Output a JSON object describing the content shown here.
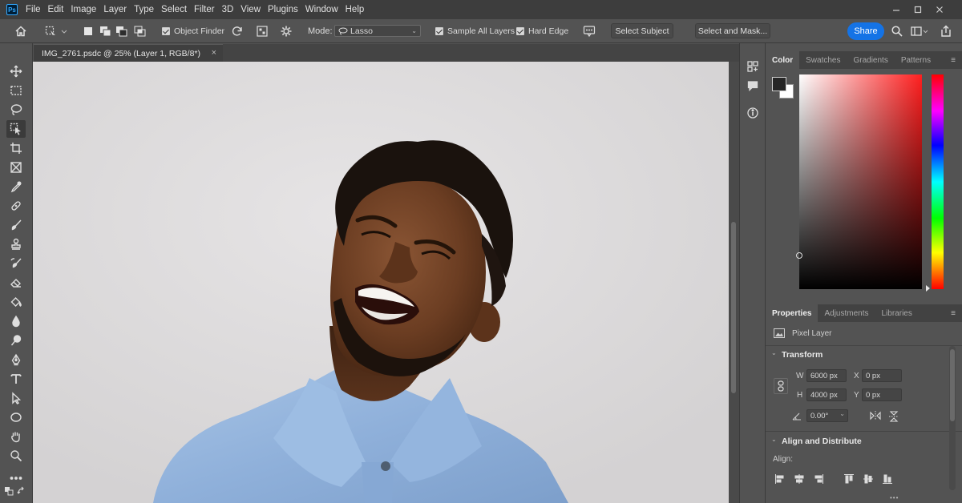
{
  "menubar": {
    "logo": "Ps",
    "items": [
      "File",
      "Edit",
      "Image",
      "Layer",
      "Type",
      "Select",
      "Filter",
      "3D",
      "View",
      "Plugins",
      "Window",
      "Help"
    ],
    "window_controls": [
      "minimize-icon",
      "maximize-icon",
      "close-icon"
    ]
  },
  "options_bar": {
    "object_finder_label": "Object Finder",
    "object_finder_checked": true,
    "mode_label": "Mode:",
    "mode_value": "Lasso",
    "sample_all_layers_label": "Sample All Layers",
    "sample_all_layers_checked": true,
    "hard_edge_label": "Hard Edge",
    "hard_edge_checked": true,
    "select_subject_label": "Select Subject",
    "select_and_mask_label": "Select and Mask...",
    "share_label": "Share",
    "accent_color": "#1473e6"
  },
  "toolbar": {
    "tools": [
      "move-icon",
      "marquee-icon",
      "lasso-icon",
      "object-selection-icon",
      "crop-icon",
      "frame-icon",
      "eyedropper-icon",
      "healing-brush-icon",
      "brush-icon",
      "clone-stamp-icon",
      "history-brush-icon",
      "eraser-icon",
      "paint-bucket-icon",
      "blur-icon",
      "dodge-icon",
      "pen-icon",
      "type-icon",
      "path-selection-icon",
      "ellipse-icon",
      "hand-icon",
      "zoom-icon",
      "more-tools-icon"
    ],
    "active_tool": "object-selection-icon"
  },
  "document": {
    "tab_title": "IMG_2761.psdc @ 25% (Layer 1, RGB/8*)",
    "close_glyph": "×"
  },
  "color_panel": {
    "tabs": [
      "Color",
      "Swatches",
      "Gradients",
      "Patterns"
    ],
    "active_tab": "Color",
    "foreground": "#262626",
    "background": "#ffffff",
    "hue": "#ff0000"
  },
  "properties_panel": {
    "tabs": [
      "Properties",
      "Adjustments",
      "Libraries"
    ],
    "active_tab": "Properties",
    "layer_type": "Pixel Layer",
    "transform_heading": "Transform",
    "w_label": "W",
    "w_value": "6000 px",
    "h_label": "H",
    "h_value": "4000 px",
    "x_label": "X",
    "x_value": "0 px",
    "y_label": "Y",
    "y_value": "0 px",
    "angle_value": "0.00°",
    "align_heading": "Align and Distribute",
    "align_label": "Align:",
    "more_glyph": "•••"
  }
}
